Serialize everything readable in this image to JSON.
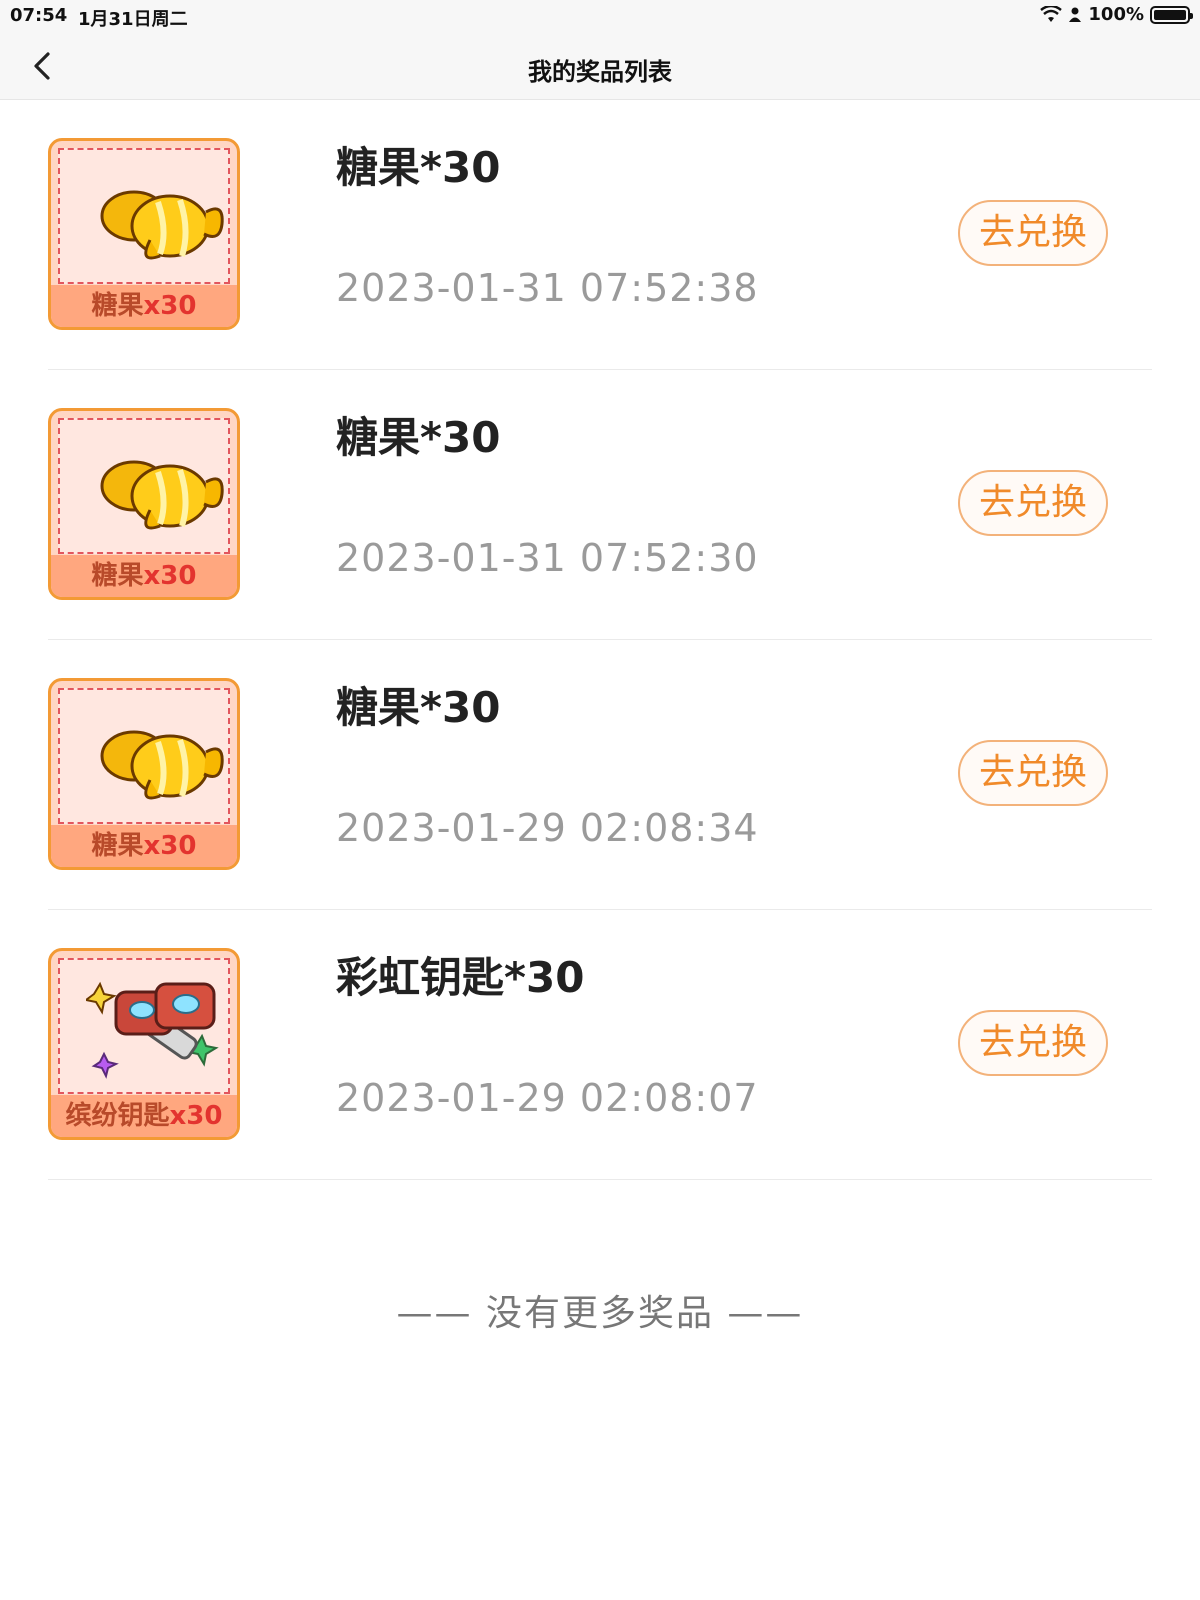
{
  "status": {
    "time": "07:54",
    "date": "1月31日周二",
    "battery": "100%"
  },
  "nav": {
    "title": "我的奖品列表"
  },
  "items": [
    {
      "name": "糖果*30",
      "time": "2023-01-31 07:52:38",
      "button": "去兑换",
      "thumb_label": "糖果",
      "thumb_qty": "x30",
      "icon": "candy-icon"
    },
    {
      "name": "糖果*30",
      "time": "2023-01-31 07:52:30",
      "button": "去兑换",
      "thumb_label": "糖果",
      "thumb_qty": "x30",
      "icon": "candy-icon"
    },
    {
      "name": "糖果*30",
      "time": "2023-01-29 02:08:34",
      "button": "去兑换",
      "thumb_label": "糖果",
      "thumb_qty": "x30",
      "icon": "candy-icon"
    },
    {
      "name": "彩虹钥匙*30",
      "time": "2023-01-29 02:08:07",
      "button": "去兑换",
      "thumb_label": "缤纷钥匙",
      "thumb_qty": "x30",
      "icon": "key-icon"
    }
  ],
  "footer": {
    "text": "—— 没有更多奖品 ——"
  },
  "colors": {
    "accent": "#f08a2a",
    "thumb_border": "#f39a35",
    "divider": "#eaeaea"
  }
}
